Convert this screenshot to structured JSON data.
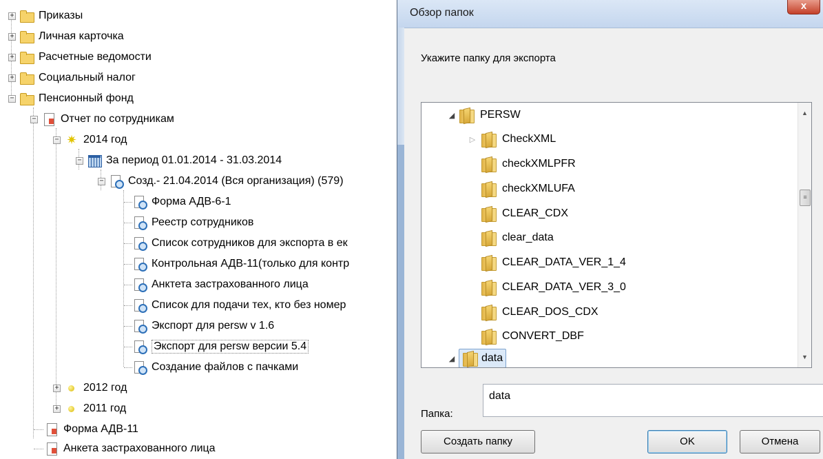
{
  "tree": {
    "items": [
      {
        "label": "Приказы"
      },
      {
        "label": "Личная карточка"
      },
      {
        "label": "Расчетные ведомости"
      },
      {
        "label": "Социальный налог"
      },
      {
        "label": "Пенсионный фонд"
      },
      {
        "label": "Отчет по сотрудникам"
      },
      {
        "label": "2014 год"
      },
      {
        "label": "За период 01.01.2014 - 31.03.2014"
      },
      {
        "label": "Созд.-  21.04.2014 (Вся организация) (579)"
      },
      {
        "label": "Форма АДВ-6-1"
      },
      {
        "label": "Реестр сотрудников"
      },
      {
        "label": "Список сотрудников для экспорта в ек"
      },
      {
        "label": "Контрольная АДВ-11(только для контр"
      },
      {
        "label": "Анктета застрахованного лица"
      },
      {
        "label": "Список для подачи тех, кто без номер"
      },
      {
        "label": "Экспорт для persw v 1.6"
      },
      {
        "label": "Экспорт для persw версии 5.4"
      },
      {
        "label": "Создание файлов с пачками"
      },
      {
        "label": "2012 год"
      },
      {
        "label": "2011 год"
      },
      {
        "label": "Форма АДВ-11"
      },
      {
        "label": "Анкета застрахованного лица"
      }
    ],
    "expand_plus": "+",
    "expand_minus": "−"
  },
  "dialog": {
    "title": "Обзор папок",
    "close_label": "x",
    "prompt": "Укажите папку для экспорта",
    "folders": [
      {
        "label": "PERSW"
      },
      {
        "label": "CheckXML"
      },
      {
        "label": "checkXMLPFR"
      },
      {
        "label": "checkXMLUFA"
      },
      {
        "label": "CLEAR_CDX"
      },
      {
        "label": "clear_data"
      },
      {
        "label": "CLEAR_DATA_VER_1_4"
      },
      {
        "label": "CLEAR_DATA_VER_3_0"
      },
      {
        "label": "CLEAR_DOS_CDX"
      },
      {
        "label": "CONVERT_DBF"
      },
      {
        "label": "data"
      }
    ],
    "folder_label": "Папка:",
    "folder_value": "data",
    "new_folder_button": "Создать папку",
    "ok_button": "OK",
    "cancel_button": "Отмена"
  },
  "colors": {
    "selection": "#dbe9f8",
    "title_bar": "#c4d6ee",
    "close": "#c4412a"
  }
}
